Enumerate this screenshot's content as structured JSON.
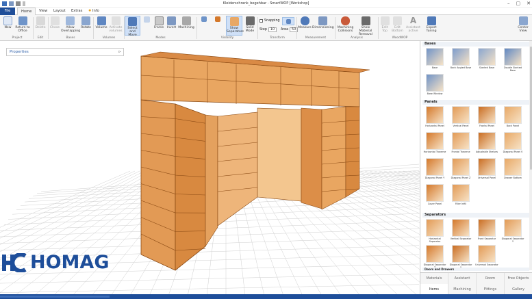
{
  "window": {
    "title": "Kleiderschrank_begehbar - SmartWOP [Workshop]",
    "controls": [
      "–",
      "▢",
      "✕"
    ]
  },
  "tabs": [
    "File",
    "Home",
    "View",
    "Layout",
    "Extras",
    "Info"
  ],
  "ribbon": {
    "buttons": {
      "new": "New",
      "return_office": "Return to Office",
      "delete": "Delete",
      "chose": "Chose",
      "allow_overlapping": "Allow Overlapping",
      "rotate": "Rotate",
      "volume": "Volume",
      "activate_volumes": "Activate volumes",
      "select_move": "Select and Move",
      "frame": "Frame",
      "invert": "Invert",
      "machining": "Machining",
      "show_separators": "Show Separators",
      "solid_mode": "Solid Mode",
      "snapping": "Snapping",
      "step_label": "Step",
      "step_value": "10",
      "area_label": "Area",
      "area_value": "50",
      "measure": "Measure",
      "dimensioning": "Dimensioning",
      "machining_collisions": "Machining Collisions",
      "show_material_removal": "Show Material Removal",
      "edit_top": "Edit Top",
      "edit_bottom": "Edit Bottom",
      "assistant_active": "Assistant active",
      "export_tuning": "Export Tuning",
      "center_view": "Center View"
    },
    "groups": [
      "Project",
      "Edit",
      "Bases",
      "Volumes",
      "Modes",
      "Visibility",
      "Transform",
      "Measurement",
      "Analysis",
      "WoodWOP"
    ]
  },
  "left_panel": {
    "title": "Properties",
    "pin": "⊳"
  },
  "catalog": {
    "sections": {
      "bases": "Bases",
      "panels": "Panels",
      "separators": "Separators",
      "doors": "Doors and Drawers"
    },
    "bases_items": [
      "Base",
      "Back Angled Base",
      "Slanted Base",
      "Double Slanted Base",
      "Base Window"
    ],
    "panel_items": [
      "Horizontal Panel",
      "Vertical Panel",
      "Frontal Panel",
      "Back Panel",
      "Horizontal Traverse",
      "Frontal Traverse",
      "Adjustable Shelves",
      "Diagonal Panel V",
      "Diagonal Panel Y",
      "Diagonal Panel Z",
      "Universal Panel",
      "Drawer Bottom",
      "Cover Panel",
      "Filler Infill"
    ],
    "separator_items": [
      "Horizontal Separator",
      "Vertical Separator",
      "Front Separator",
      "Diagonal Separator Y",
      "Diagonal Separator Z",
      "Diagonal Separator X",
      "Universal Separator"
    ],
    "bottom_tabs": [
      "Materials",
      "Assistant",
      "Room",
      "Free Objects",
      "Items",
      "Machining",
      "Fittings",
      "Gallery"
    ]
  },
  "logo": {
    "text": "HOMAG",
    "mark": "HC"
  },
  "colors": {
    "accent": "#1e4e9a",
    "cabinet": "#d4782a",
    "cabinet_light": "#e8a866",
    "grid": "#cfcfcf"
  }
}
